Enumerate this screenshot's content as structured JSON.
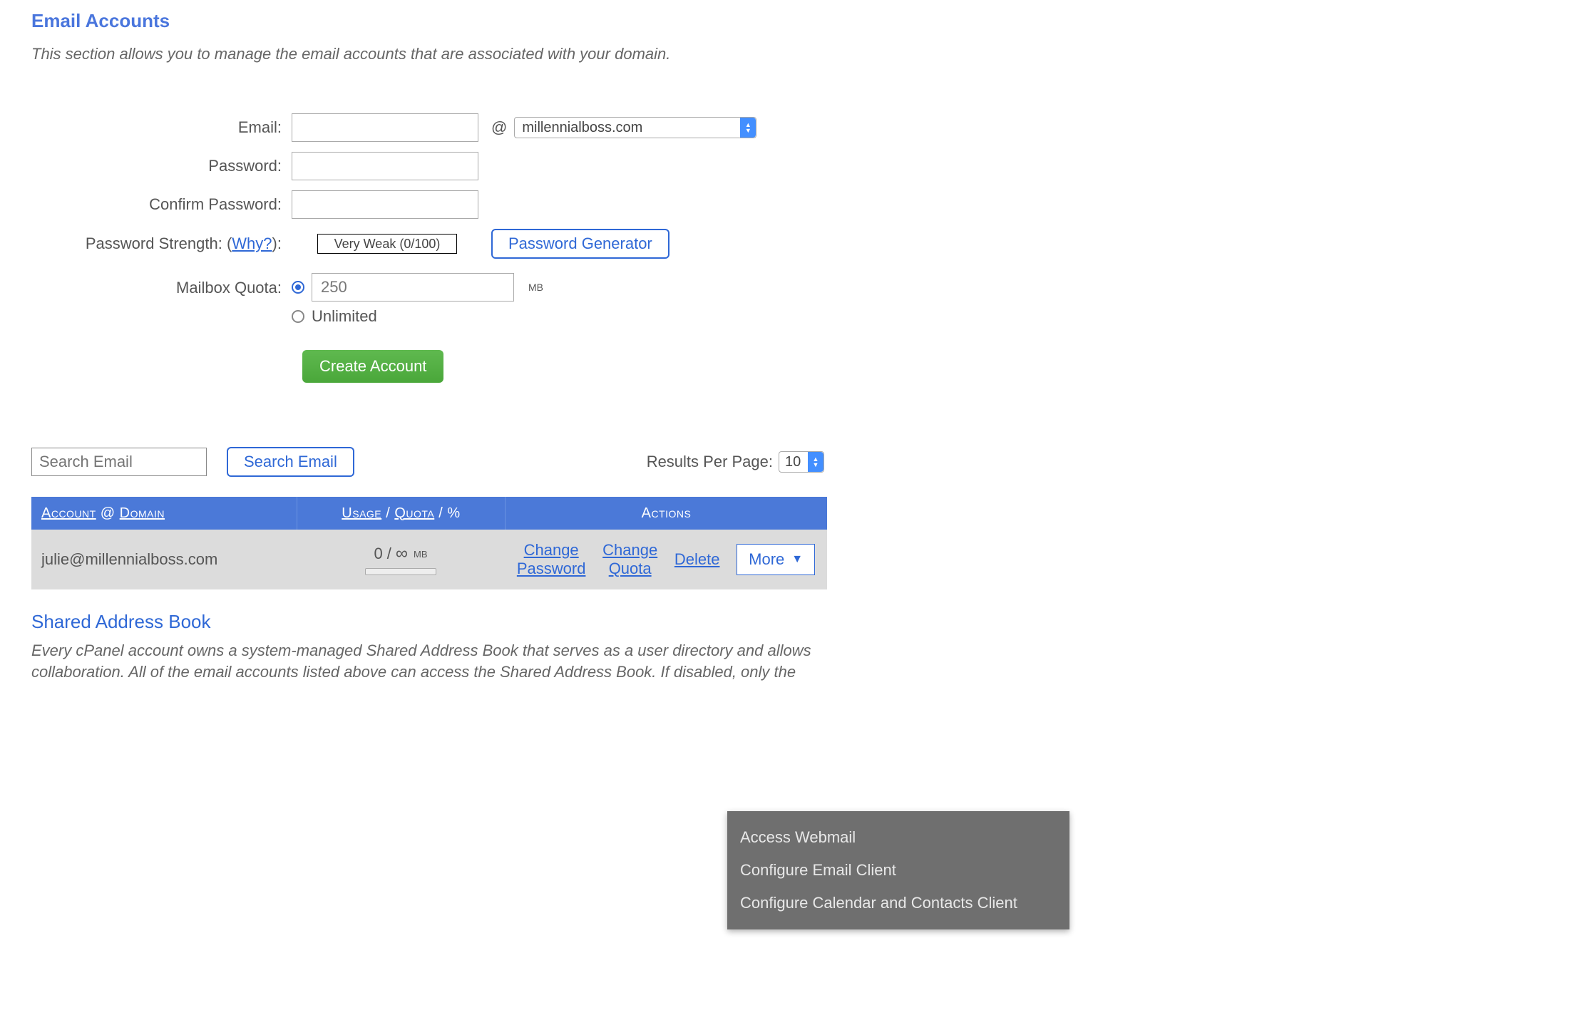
{
  "header": {
    "title": "Email Accounts",
    "description": "This section allows you to manage the email accounts that are associated with your domain."
  },
  "form": {
    "email_label": "Email:",
    "at": "@",
    "domain": "millennialboss.com",
    "password_label": "Password:",
    "confirm_label": "Confirm Password:",
    "strength_label_prefix": "Password Strength: (",
    "strength_why": "Why?",
    "strength_label_suffix": "):",
    "strength_value": "Very Weak (0/100)",
    "pw_generator": "Password Generator",
    "quota_label": "Mailbox Quota:",
    "quota_value": "250",
    "quota_unit": "MB",
    "unlimited_label": "Unlimited",
    "create_button": "Create Account"
  },
  "search": {
    "placeholder": "Search Email",
    "button": "Search Email",
    "results_label": "Results Per Page:",
    "results_value": "10"
  },
  "table": {
    "col_account_prefix": "Account",
    "col_account_at": " @ ",
    "col_account_suffix": "Domain",
    "col_usage_prefix": "Usage",
    "col_usage_sep1": " / ",
    "col_usage_mid": "Quota",
    "col_usage_sep2": " / %",
    "col_actions": "Actions",
    "rows": [
      {
        "account": "julie@millennialboss.com",
        "usage": "0",
        "slash": " / ",
        "infinity": "∞",
        "unit": "MB",
        "change_pw": "Change\nPassword",
        "change_quota": "Change\nQuota",
        "delete": "Delete",
        "more": "More"
      }
    ]
  },
  "dropdown": {
    "item1": "Access Webmail",
    "item2": "Configure Email Client",
    "item3": "Configure Calendar and Contacts Client"
  },
  "sab": {
    "title": "Shared Address Book",
    "desc": "Every cPanel account owns a system-managed Shared Address Book that serves as a user directory and allows collaboration. All of the email accounts listed above can access the Shared Address Book. If disabled, only the"
  }
}
